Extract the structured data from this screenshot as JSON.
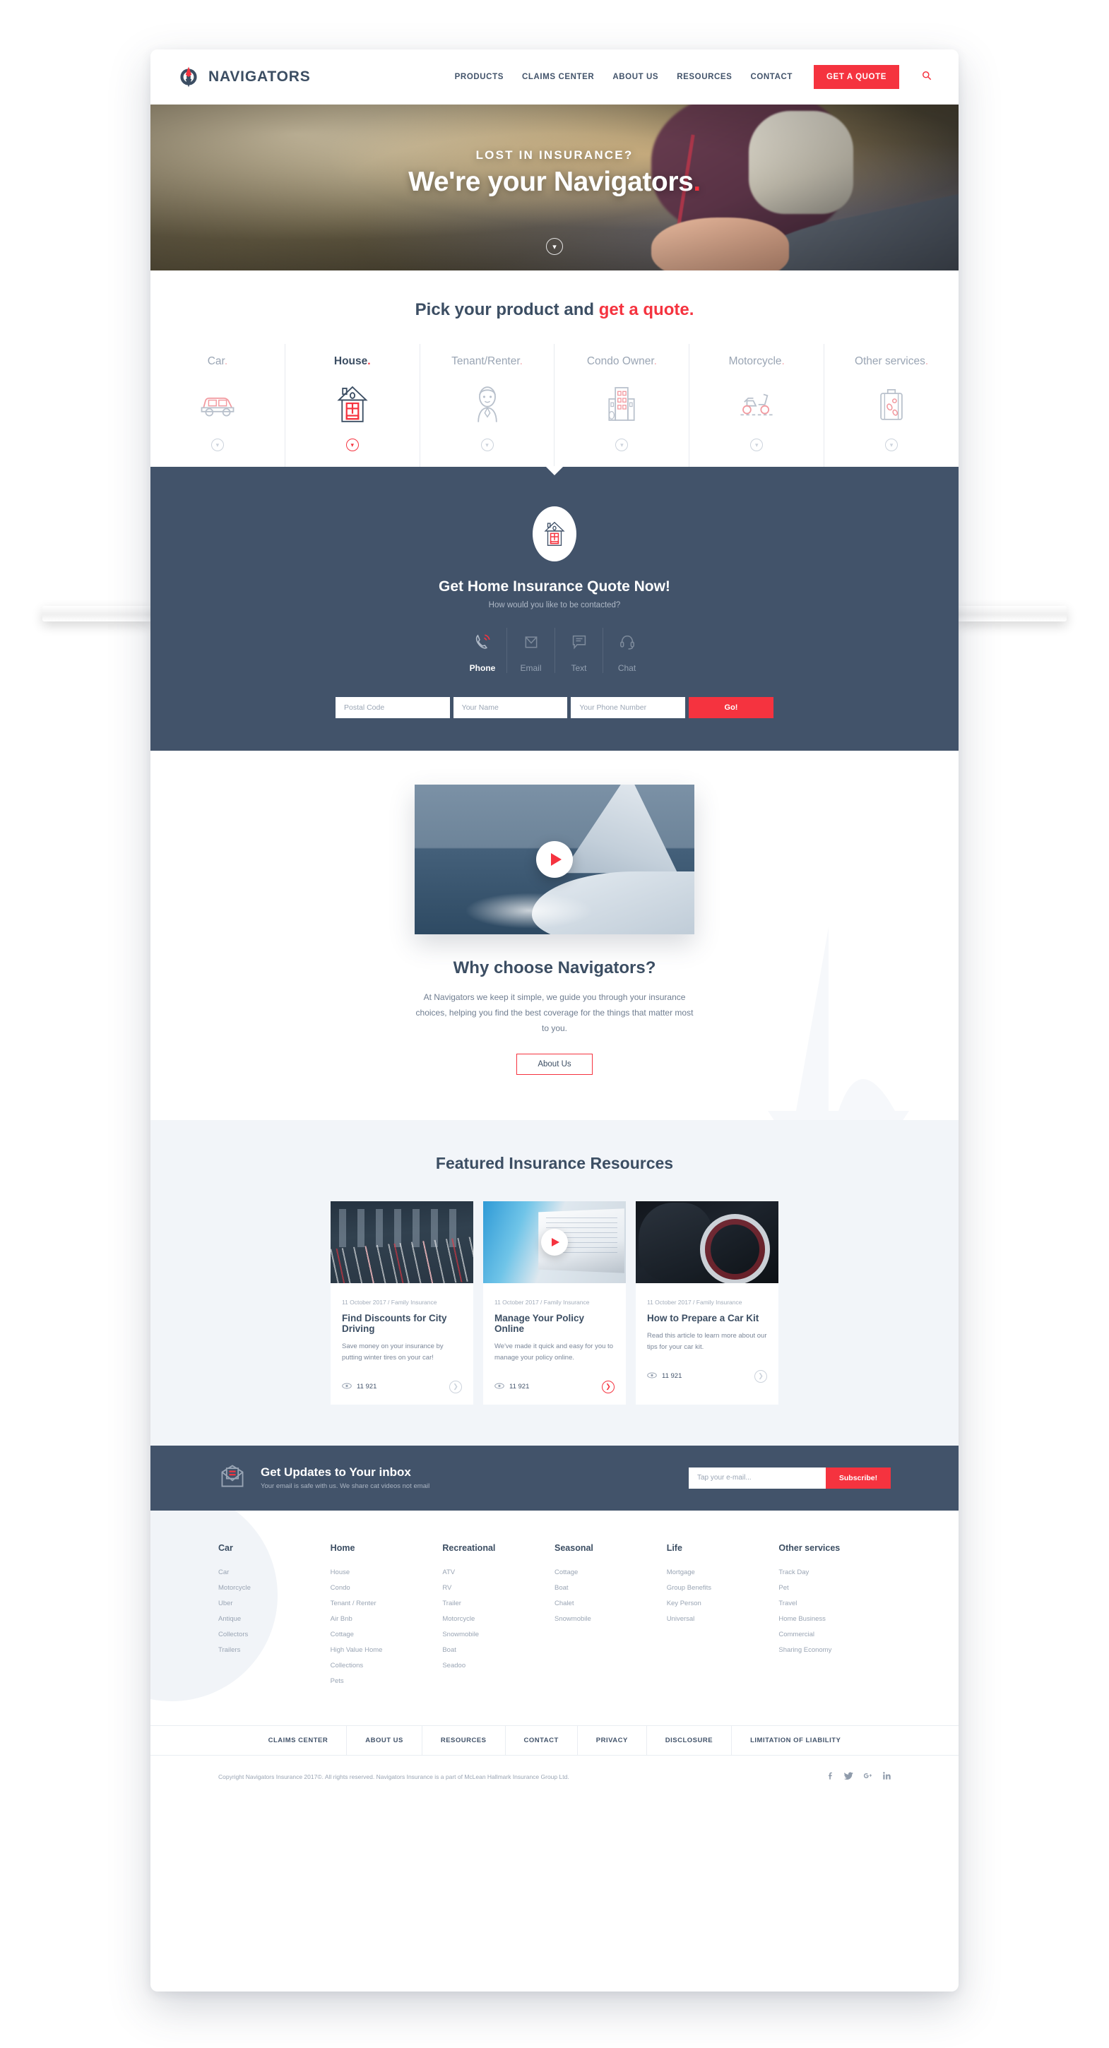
{
  "header": {
    "brand": "NAVIGATORS",
    "nav": [
      {
        "label": "PRODUCTS"
      },
      {
        "label": "CLAIMS CENTER"
      },
      {
        "label": "ABOUT US"
      },
      {
        "label": "RESOURCES"
      },
      {
        "label": "CONTACT"
      }
    ],
    "quote_button": "GET A QUOTE",
    "search_icon": "search-icon"
  },
  "hero": {
    "kicker": "LOST IN INSURANCE?",
    "title": "We're your Navigators",
    "title_dot": ".",
    "scroll_icon": "chevron-down-icon"
  },
  "picker": {
    "heading_plain": "Pick your product and ",
    "heading_highlight": "get a quote.",
    "tabs": [
      {
        "label": "Car",
        "dot": ".",
        "icon": "car-icon",
        "active": false
      },
      {
        "label": "House",
        "dot": ".",
        "icon": "house-icon",
        "active": true
      },
      {
        "label": "Tenant/Renter",
        "dot": ".",
        "icon": "person-icon",
        "active": false
      },
      {
        "label": "Condo Owner",
        "dot": ".",
        "icon": "building-icon",
        "active": false
      },
      {
        "label": "Motorcycle",
        "dot": ".",
        "icon": "scooter-icon",
        "active": false
      },
      {
        "label": "Other services",
        "dot": ".",
        "icon": "suitcase-icon",
        "active": false
      }
    ]
  },
  "quote": {
    "badge_icon": "house-icon",
    "title": "Get Home Insurance Quote Now!",
    "subtitle": "How would you like to be contacted?",
    "channels": [
      {
        "label": "Phone",
        "icon": "phone-icon",
        "active": true
      },
      {
        "label": "Email",
        "icon": "envelope-icon",
        "active": false
      },
      {
        "label": "Text",
        "icon": "chat-bubble-icon",
        "active": false
      },
      {
        "label": "Chat",
        "icon": "headset-icon",
        "active": false
      }
    ],
    "fields": [
      {
        "placeholder": "Postal Code",
        "value": ""
      },
      {
        "placeholder": "Your Name",
        "value": ""
      },
      {
        "placeholder": "Your Phone Number",
        "value": ""
      }
    ],
    "submit": "Go!"
  },
  "why": {
    "play_icon": "play-icon",
    "title": "Why choose Navigators?",
    "text": "At Navigators we keep it simple, we guide you through your insurance choices, helping you find the best coverage for the things that matter most to you.",
    "button": "About Us"
  },
  "resources": {
    "title": "Featured Insurance Resources",
    "cards": [
      {
        "meta": "11 October 2017 / Family Insurance",
        "title": "Find Discounts for City Driving",
        "desc": "Save money on your insurance by putting winter tires on your car!",
        "views": "11 921",
        "views_icon": "eye-icon",
        "arrow_icon": "chevron-right-icon",
        "arrow_highlight": false,
        "has_video": false,
        "image": "city-traffic-night-photo"
      },
      {
        "meta": "11 October 2017 / Family Insurance",
        "title": "Manage Your Policy Online",
        "desc": "We've made it quick and easy for you to manage your policy online.",
        "views": "11 921",
        "views_icon": "eye-icon",
        "arrow_icon": "chevron-right-icon",
        "arrow_highlight": true,
        "has_video": true,
        "image": "laptop-dashboard-photo"
      },
      {
        "meta": "11 October 2017 / Family Insurance",
        "title": "How to Prepare a Car Kit",
        "desc": "Read this article to learn more about our tips for your car kit.",
        "views": "11 921",
        "views_icon": "eye-icon",
        "arrow_icon": "chevron-right-icon",
        "arrow_highlight": false,
        "has_video": false,
        "image": "car-dashboard-photo"
      }
    ]
  },
  "newsletter": {
    "icon": "envelope-icon",
    "heading": "Get Updates to Your inbox",
    "subheading": "Your email is safe with us. We share cat videos not email",
    "input_placeholder": "Tap your e-mail...",
    "input_value": "",
    "button": "Subscribe!"
  },
  "footer": {
    "columns": [
      {
        "title": "Car",
        "links": [
          "Car",
          "Motorcycle",
          "Uber",
          "Antique",
          "Collectors",
          "Trailers"
        ]
      },
      {
        "title": "Home",
        "links": [
          "House",
          "Condo",
          "Tenant / Renter",
          "Air Bnb",
          "Cottage",
          "High Value Home",
          "Collections",
          "Pets"
        ]
      },
      {
        "title": "Recreational",
        "links": [
          "ATV",
          "RV",
          "Trailer",
          "Motorcycle",
          "Snowmobile",
          "Boat",
          "Seadoo"
        ]
      },
      {
        "title": "Seasonal",
        "links": [
          "Cottage",
          "Boat",
          "Chalet",
          "Snowmobile"
        ]
      },
      {
        "title": "Life",
        "links": [
          "Mortgage",
          "Group Benefits",
          "Key Person",
          "Universal"
        ]
      },
      {
        "title": "Other services",
        "links": [
          "Track Day",
          "Pet",
          "Travel",
          "Home Business",
          "Commercial",
          "Sharing Economy"
        ]
      }
    ],
    "nav": [
      "CLAIMS CENTER",
      "ABOUT US",
      "RESOURCES",
      "CONTACT",
      "PRIVACY",
      "DISCLOSURE",
      "LIMITATION OF LIABILITY"
    ],
    "copyright": "Copyright Navigators Insurance 2017©. All rights reserved. Navigators Insurance is a part of McLean Hallmark Insurance Group Ltd.",
    "socials": [
      {
        "name": "facebook-icon",
        "glyph": "f"
      },
      {
        "name": "twitter-icon",
        "glyph": "✓"
      },
      {
        "name": "google-plus-icon",
        "glyph": "g+"
      },
      {
        "name": "linkedin-icon",
        "glyph": "in"
      }
    ]
  },
  "colors": {
    "accent_red": "#f5333f",
    "dark_blue": "#42536a",
    "light_bg": "#f2f5f9"
  }
}
